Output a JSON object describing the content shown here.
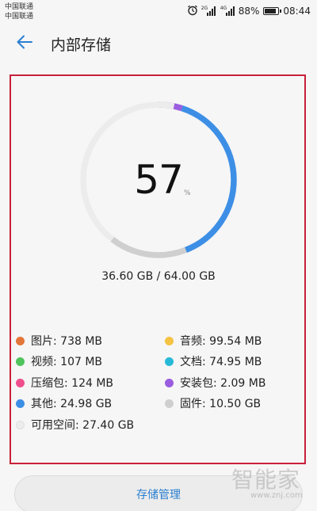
{
  "status_bar": {
    "carrier_1": "中国联通",
    "carrier_2": "中国联通",
    "signal_1_label": "2G",
    "signal_2_label": "4G",
    "battery": "88%",
    "time": "08:44"
  },
  "header": {
    "title": "内部存储"
  },
  "storage": {
    "percent": "57",
    "percent_sign": "%",
    "usage": "36.60 GB / 64.00 GB"
  },
  "chart_data": {
    "type": "pie",
    "title": "",
    "slices": [
      {
        "label": "图片",
        "value_gb": 0.738,
        "color": "#e3763a"
      },
      {
        "label": "音频",
        "value_gb": 0.0995,
        "color": "#f5c242"
      },
      {
        "label": "视频",
        "value_gb": 0.107,
        "color": "#4fc35d"
      },
      {
        "label": "文档",
        "value_gb": 0.075,
        "color": "#27b9d8"
      },
      {
        "label": "压缩包",
        "value_gb": 0.124,
        "color": "#ef4f8c"
      },
      {
        "label": "安装包",
        "value_gb": 2.09,
        "color": "#9b5de0"
      },
      {
        "label": "其他",
        "value_gb": 24.98,
        "color": "#3d8fe6"
      },
      {
        "label": "固件",
        "value_gb": 10.5,
        "color": "#cfcfcf"
      },
      {
        "label": "可用空间",
        "value_gb": 27.4,
        "color": "#ececec"
      }
    ],
    "total_gb": 64.0
  },
  "legend": [
    {
      "text": "图片: 738 MB",
      "color": "#e3763a"
    },
    {
      "text": "音频: 99.54 MB",
      "color": "#f5c242"
    },
    {
      "text": "视频: 107 MB",
      "color": "#4fc35d"
    },
    {
      "text": "文档: 74.95 MB",
      "color": "#27b9d8"
    },
    {
      "text": "压缩包: 124 MB",
      "color": "#ef4f8c"
    },
    {
      "text": "安装包: 2.09 MB",
      "color": "#9b5de0"
    },
    {
      "text": "其他: 24.98 GB",
      "color": "#3d8fe6"
    },
    {
      "text": "固件: 10.50 GB",
      "color": "#cfcfcf"
    },
    {
      "text": "可用空间: 27.40 GB",
      "color": "#ececec"
    }
  ],
  "actions": {
    "manage_label": "存储管理"
  },
  "watermark": {
    "name": "智能家",
    "url": "www.znj.com"
  },
  "icons": {
    "back": "arrow-left-icon",
    "alarm": "alarm-icon",
    "battery": "battery-icon"
  },
  "colors": {
    "accent": "#3d8fe6",
    "frame": "#c8203a",
    "button_text": "#2a7fd0"
  }
}
